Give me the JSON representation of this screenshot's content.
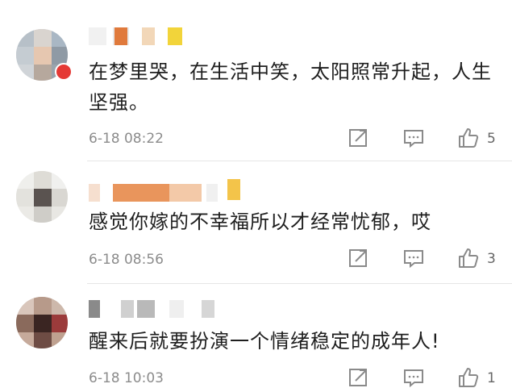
{
  "comments": [
    {
      "text": "在梦里哭，在生活中笑，太阳照常升起，人生坚强。",
      "time": "6-18 08:22",
      "likes": "5"
    },
    {
      "text": "感觉你嫁的不幸福所以才经常忧郁，哎",
      "time": "6-18 08:56",
      "likes": "3"
    },
    {
      "text": "醒来后就要扮演一个情绪稳定的成年人!",
      "time": "6-18 10:03",
      "likes": "1"
    }
  ],
  "icons": {
    "share": "share-icon",
    "reply": "comment-icon",
    "like": "thumbs-up-icon"
  },
  "colors": {
    "text": "#1e1e1e",
    "meta": "#8c8c8c",
    "icon": "#8a8a8a",
    "badge": "#e53935"
  }
}
